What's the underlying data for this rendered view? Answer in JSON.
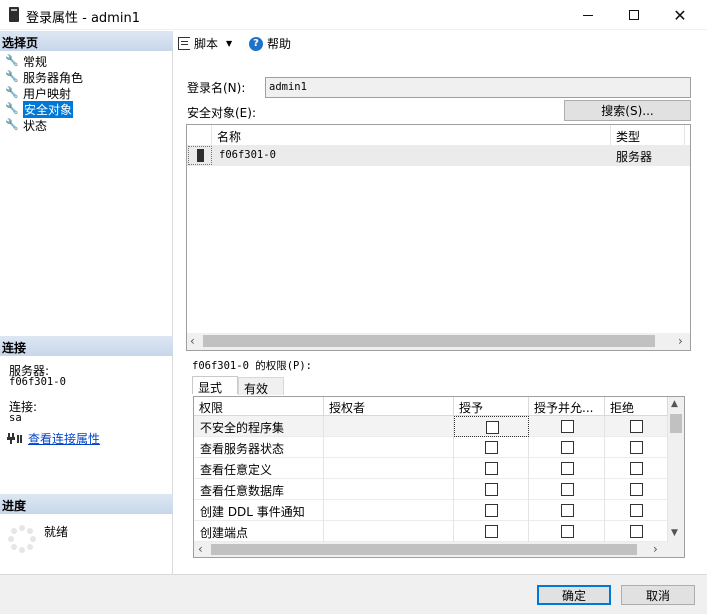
{
  "window": {
    "title": "登录属性 - admin1"
  },
  "left_pane": {
    "select_page_header": "选择页",
    "pages": [
      {
        "label": "常规",
        "icon": "wrench-icon"
      },
      {
        "label": "服务器角色",
        "icon": "wrench-icon"
      },
      {
        "label": "用户映射",
        "icon": "wrench-icon"
      },
      {
        "label": "安全对象",
        "icon": "wrench-icon",
        "selected": true
      },
      {
        "label": "状态",
        "icon": "wrench-icon"
      }
    ],
    "connection_header": "连接",
    "server_label": "服务器:",
    "server_value": "f06f301-0",
    "connection_label": "连接:",
    "connection_value": "sa",
    "view_connection_link": "查看连接属性",
    "progress_header": "进度",
    "progress_status": "就绪"
  },
  "toolbar": {
    "script_label": "脚本",
    "help_label": "帮助"
  },
  "main": {
    "login_name_label": "登录名(N):",
    "login_name_value": "admin1",
    "securables_label": "安全对象(E):",
    "search_button": "搜索(S)...",
    "securables_columns": [
      "名称",
      "类型"
    ],
    "securables_rows": [
      {
        "name": "f06f301-0",
        "type": "服务器"
      }
    ],
    "permissions_label": "f06f301-0 的权限(P):",
    "tabs": [
      "显式",
      "有效"
    ],
    "permission_columns": [
      "权限",
      "授权者",
      "授予",
      "授予并允...",
      "拒绝"
    ],
    "permission_rows": [
      {
        "name": "不安全的程序集",
        "grantor": "",
        "grant": false,
        "with_grant": false,
        "deny": false
      },
      {
        "name": "查看服务器状态",
        "grantor": "",
        "grant": false,
        "with_grant": false,
        "deny": false
      },
      {
        "name": "查看任意定义",
        "grantor": "",
        "grant": false,
        "with_grant": false,
        "deny": false
      },
      {
        "name": "查看任意数据库",
        "grantor": "",
        "grant": false,
        "with_grant": false,
        "deny": false
      },
      {
        "name": "创建 DDL 事件通知",
        "grantor": "",
        "grant": false,
        "with_grant": false,
        "deny": false
      },
      {
        "name": "创建端点",
        "grantor": "",
        "grant": false,
        "with_grant": false,
        "deny": false
      }
    ]
  },
  "footer": {
    "ok_button": "确定",
    "cancel_button": "取消"
  }
}
